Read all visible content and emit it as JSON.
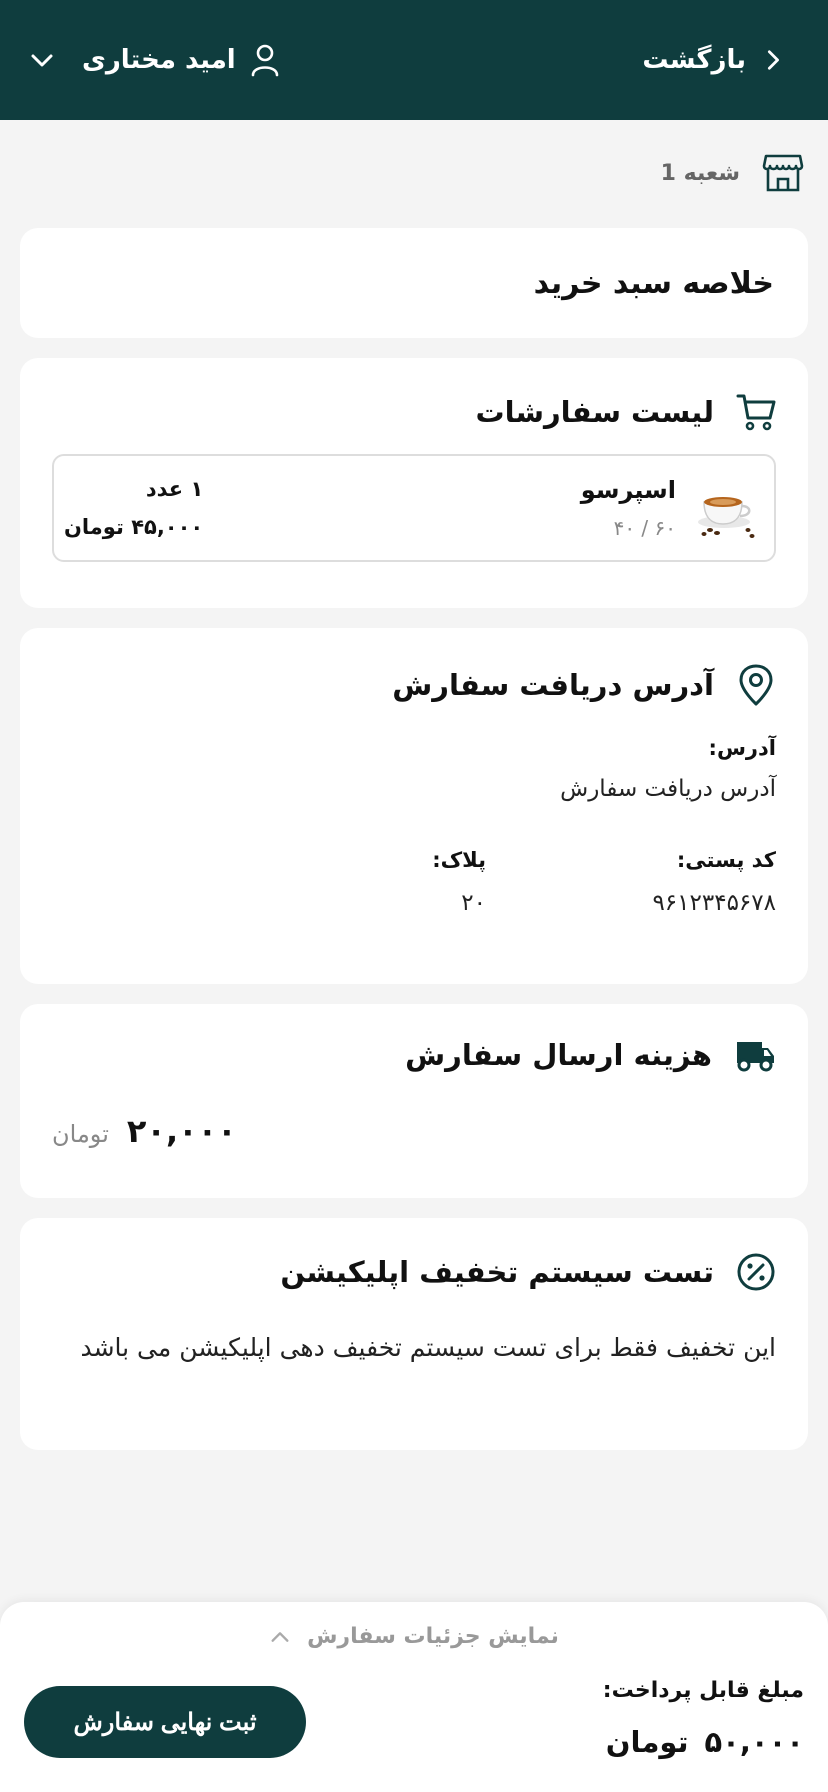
{
  "header": {
    "back_label": "بازگشت",
    "user_name": "امید مختاری",
    "bg_color": "#0f3d3e"
  },
  "branch": {
    "name": "شعبه 1"
  },
  "summary": {
    "title": "خلاصه سبد خرید"
  },
  "orders": {
    "title": "لیست سفارشات",
    "items": [
      {
        "name": "اسپرسو",
        "sub": "۶۰ / ۴۰",
        "qty": "۱ عدد",
        "price": "۴۵,۰۰۰ تومان"
      }
    ]
  },
  "address": {
    "title": "آدرس دریافت سفارش",
    "address_label": "آدرس:",
    "address_value": "آدرس دریافت سفارش",
    "postal_label": "کد پستی:",
    "postal_value": "۹۶۱۲۳۴۵۶۷۸",
    "plate_label": "پلاک:",
    "plate_value": "۲۰"
  },
  "shipping": {
    "title": "هزینه ارسال سفارش",
    "amount": "۲۰,۰۰۰",
    "unit": "تومان"
  },
  "discount": {
    "title": "تست سیستم تخفیف اپلیکیشن",
    "description": "این تخفیف فقط برای تست سیستم تخفیف دهی اپلیکیشن می باشد"
  },
  "footer": {
    "details_toggle": "نمایش جزئیات سفارش",
    "pay_label": "مبلغ قابل پرداخت:",
    "pay_amount": "۵۰,۰۰۰",
    "pay_unit": "تومان",
    "submit_label": "ثبت نهایی سفارش"
  }
}
